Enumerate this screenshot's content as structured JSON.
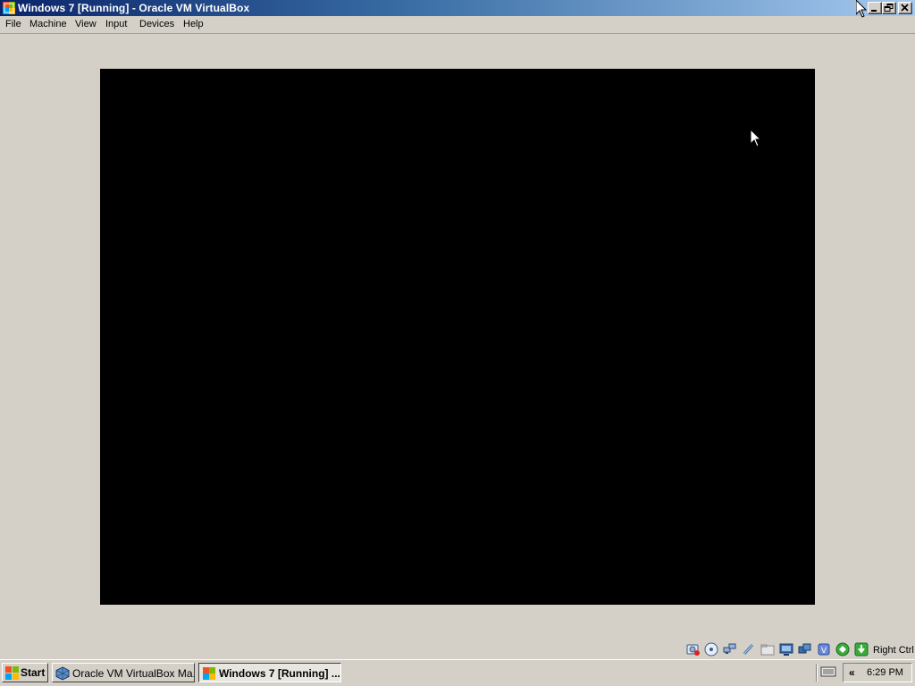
{
  "window": {
    "title": "Windows 7 [Running] - Oracle VM VirtualBox",
    "icon": "virtualbox-window-icon"
  },
  "menu": {
    "items": [
      "File",
      "Machine",
      "View",
      "Input",
      "Devices",
      "Help"
    ]
  },
  "status_bar": {
    "icons": [
      "hard-disk-icon",
      "optical-drive-icon",
      "network-icon",
      "usb-icon",
      "shared-folder-icon",
      "display-icon",
      "video-capture-icon",
      "cpu-virtualization-icon",
      "mouse-integration-icon",
      "keyboard-capture-icon"
    ],
    "host_key": "Right Ctrl"
  },
  "taskbar": {
    "start_label": "Start",
    "tasks": [
      {
        "label": "Oracle VM VirtualBox Ma...",
        "active": false
      },
      {
        "label": "Windows 7 [Running] ...",
        "active": true
      }
    ],
    "clock": "6:29 PM"
  },
  "colors": {
    "titlebar_start": "#0a246a",
    "titlebar_end": "#a6caf0",
    "chrome": "#d4d0c8",
    "vm_screen": "#000000"
  }
}
